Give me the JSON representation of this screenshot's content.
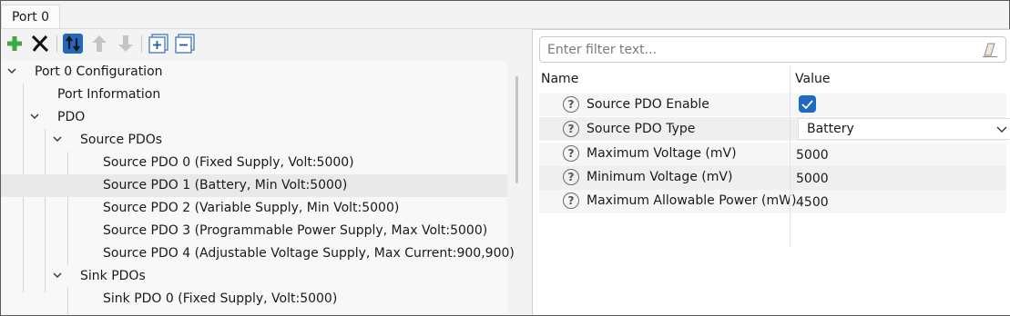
{
  "tab": {
    "label": "Port 0"
  },
  "toolbar": {
    "add": "add-icon",
    "remove": "delete-icon",
    "sort": "sort-icon",
    "up": "move-up-icon",
    "down": "move-down-icon",
    "expand": "expand-all-icon",
    "collapse": "collapse-all-icon"
  },
  "tree": {
    "items": [
      {
        "label": "Port 0 Configuration",
        "expandable": true
      },
      {
        "label": "Port Information",
        "expandable": false
      },
      {
        "label": "PDO",
        "expandable": true
      },
      {
        "label": "Source PDOs",
        "expandable": true
      },
      {
        "label": "Source PDO 0 (Fixed Supply, Volt:5000)",
        "expandable": false
      },
      {
        "label": "Source PDO 1 (Battery, Min Volt:5000)",
        "expandable": false,
        "selected": true
      },
      {
        "label": "Source PDO 2 (Variable Supply, Min Volt:5000)",
        "expandable": false
      },
      {
        "label": "Source PDO 3 (Programmable Power Supply, Max Volt:5000)",
        "expandable": false
      },
      {
        "label": "Source PDO 4 (Adjustable Voltage Supply, Max Current:900,900)",
        "expandable": false
      },
      {
        "label": "Sink PDOs",
        "expandable": true
      },
      {
        "label": "Sink PDO 0 (Fixed Supply, Volt:5000)",
        "expandable": false
      }
    ]
  },
  "properties": {
    "filter_placeholder": "Enter filter text...",
    "filter_value": "",
    "col_name": "Name",
    "col_value": "Value",
    "rows": [
      {
        "name": "Source PDO Enable",
        "type": "checkbox",
        "checked": true
      },
      {
        "name": "Source PDO Type",
        "type": "dropdown",
        "value": "Battery"
      },
      {
        "name": "Maximum Voltage (mV)",
        "type": "text",
        "value": "5000"
      },
      {
        "name": "Minimum Voltage (mV)",
        "type": "text",
        "value": "5000"
      },
      {
        "name": "Maximum Allowable Power (mW)",
        "type": "text",
        "value": "4500"
      }
    ]
  },
  "colors": {
    "accent": "#1f6ac1",
    "add_green": "#3aa845",
    "sort_blue": "#1f6ac1"
  }
}
